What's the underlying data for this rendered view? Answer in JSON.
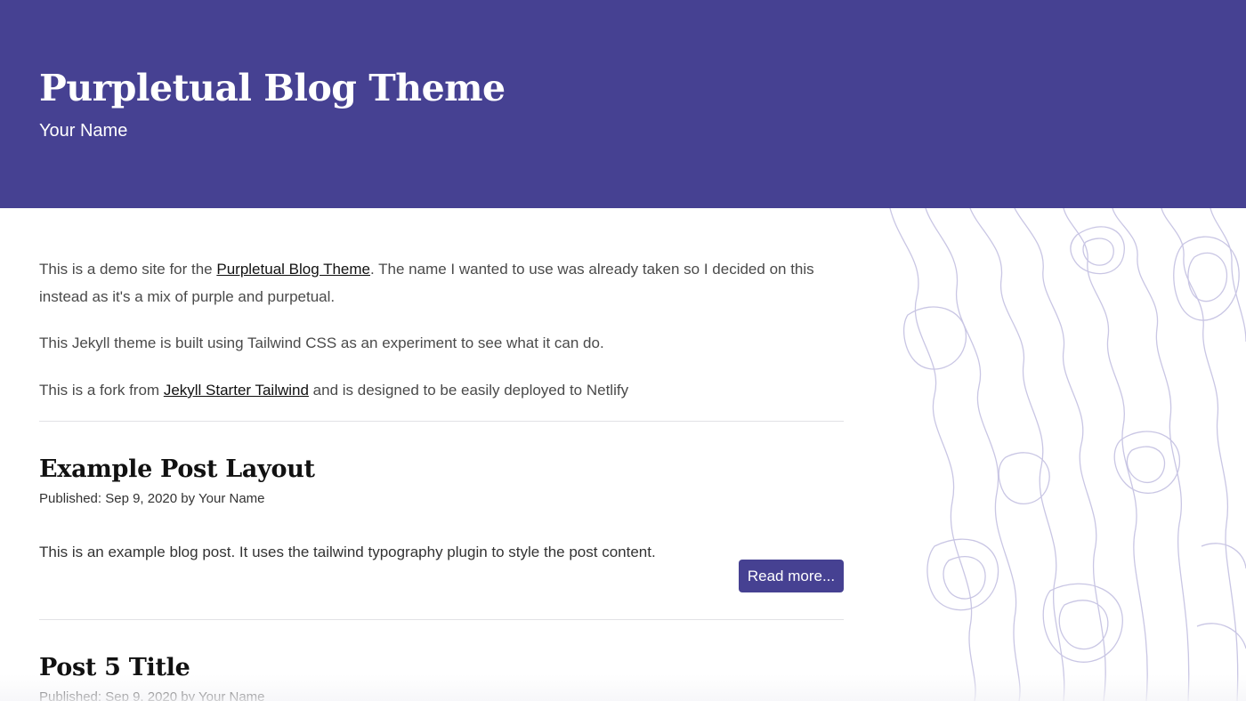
{
  "header": {
    "title": "Purpletual Blog Theme",
    "author": "Your Name"
  },
  "intro": {
    "p1_before": "This is a demo site for the ",
    "p1_link": "Purpletual Blog Theme",
    "p1_after": ". The name I wanted to use was already taken so I decided on this instead as it's a mix of purple and purpetual.",
    "p2": "This Jekyll theme is built using Tailwind CSS as an experiment to see what it can do.",
    "p3_before": "This is a fork from ",
    "p3_link": "Jekyll Starter Tailwind",
    "p3_after": " and is designed to be easily deployed to Netlify"
  },
  "posts": [
    {
      "title": "Example Post Layout",
      "meta": "Published: Sep 9, 2020 by Your Name",
      "excerpt": "This is an example blog post. It uses the tailwind typography plugin to style the post content.",
      "read_more": "Read more..."
    },
    {
      "title": "Post 5 Title",
      "meta": "Published: Sep 9, 2020 by Your Name"
    }
  ],
  "colors": {
    "brand_purple": "#464192",
    "topo_line": "#c9c6e4",
    "text": "#4a4a4a"
  }
}
